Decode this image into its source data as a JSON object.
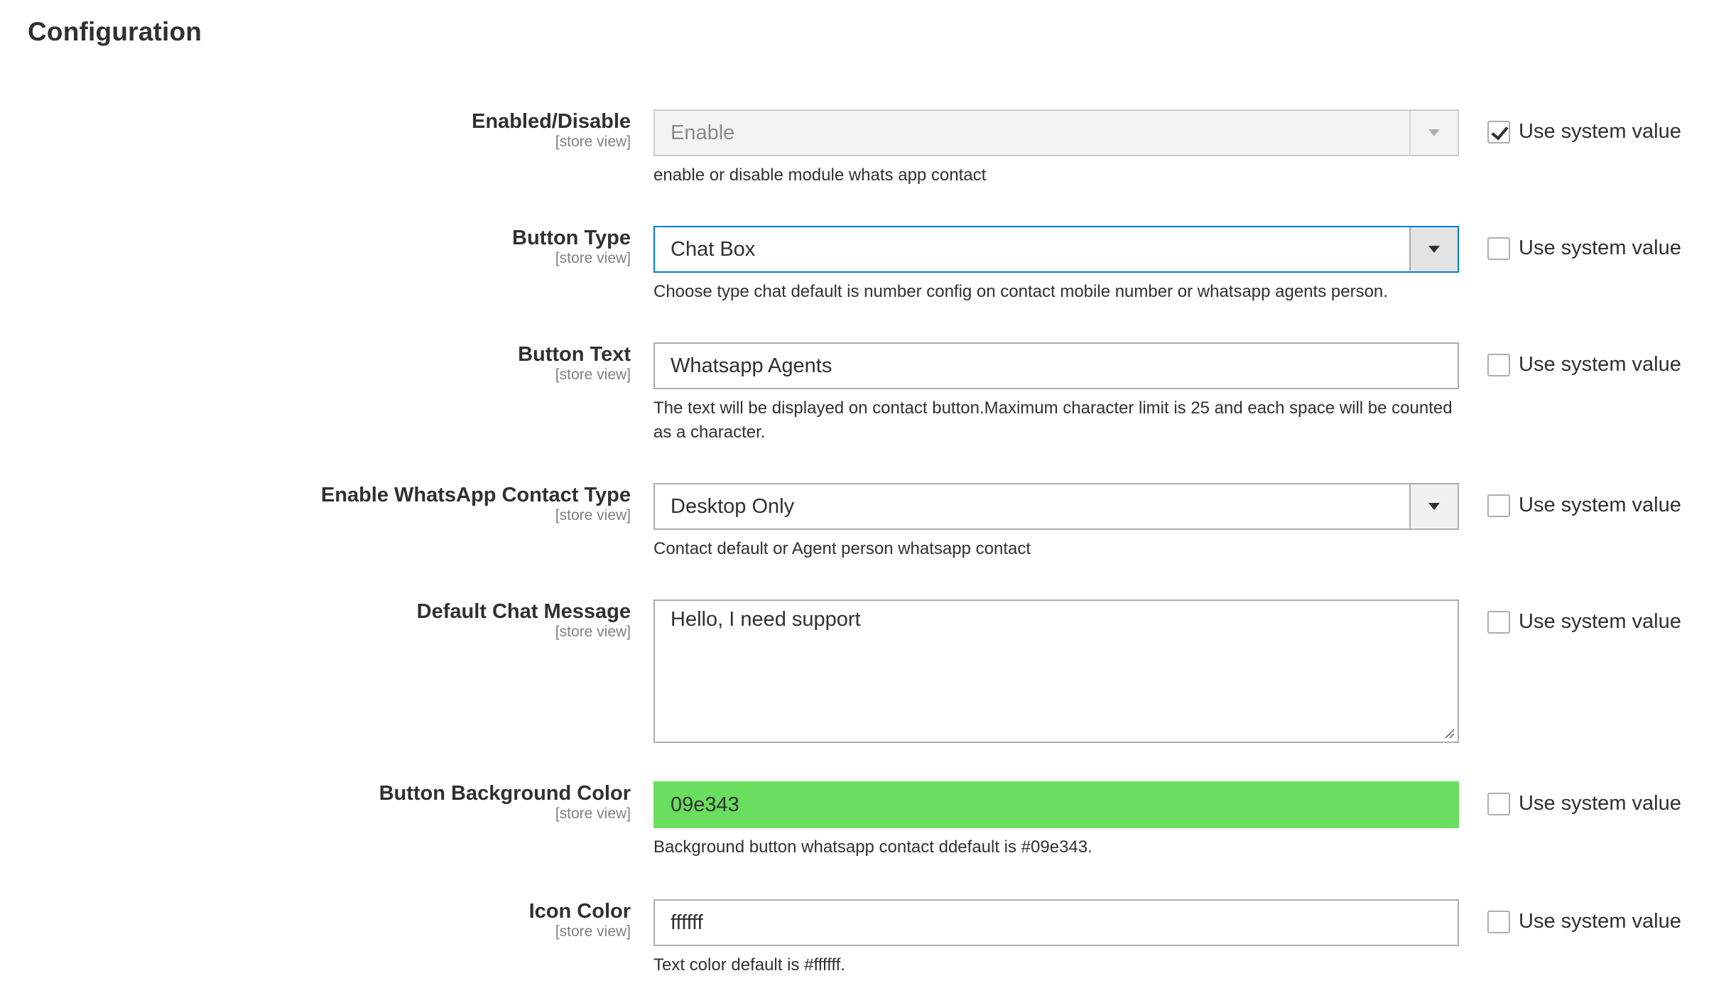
{
  "section": {
    "title": "Configuration"
  },
  "fields": [
    {
      "label": "Enabled/Disable",
      "scope": "[store view]",
      "value": "Enable",
      "note": "enable or disable module whats app contact",
      "use_system_label": "Use system value",
      "use_system_checked": true
    },
    {
      "label": "Button Type",
      "scope": "[store view]",
      "value": "Chat Box",
      "note": "Choose type chat default is number config on contact mobile number or whatsapp agents person.",
      "use_system_label": "Use system value",
      "use_system_checked": false
    },
    {
      "label": "Button Text",
      "scope": "[store view]",
      "value": "Whatsapp Agents",
      "note": "The text will be displayed on contact button.Maximum character limit is 25 and each space will be counted as a character.",
      "use_system_label": "Use system value",
      "use_system_checked": false
    },
    {
      "label": "Enable WhatsApp Contact Type",
      "scope": "[store view]",
      "value": "Desktop Only",
      "note": "Contact default or Agent person whatsapp contact",
      "use_system_label": "Use system value",
      "use_system_checked": false
    },
    {
      "label": "Default Chat Message",
      "scope": "[store view]",
      "value": "Hello, I need support",
      "use_system_label": "Use system value",
      "use_system_checked": false
    },
    {
      "label": "Button Background Color",
      "scope": "[store view]",
      "value": "09e343",
      "note": "Background button whatsapp contact ddefault is #09e343.",
      "use_system_label": "Use system value",
      "use_system_checked": false,
      "swatch_color": "#6ade5f"
    },
    {
      "label": "Icon Color",
      "scope": "[store view]",
      "value": "ffffff",
      "note": "Text color default is #ffffff.",
      "use_system_label": "Use system value",
      "use_system_checked": false
    }
  ],
  "colors": {
    "focus_border": "#007bdb",
    "field_border": "#adadad",
    "disabled_bg": "#f3f3f3"
  }
}
